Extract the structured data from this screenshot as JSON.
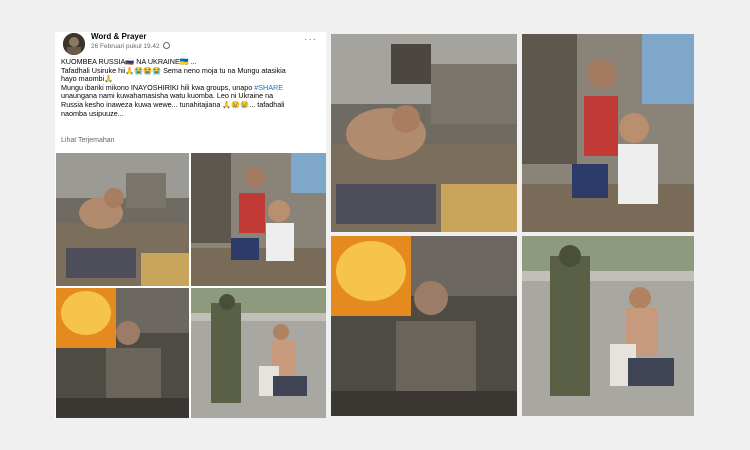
{
  "post": {
    "page_name": "Word & Prayer",
    "timestamp": "26 Februari pukul 19.42",
    "more_label": "···",
    "text_lines": [
      "KUOMBEA RUSSIA🇷🇺 NA UKRAINE🇺🇦 ...",
      "Tafadhali Usiruke hii🙏😭😭😭 Sema neno moja tu na Mungu atasikia",
      "hayo maombi🙏",
      "Mungu ibariki mikono INAYOSHIRIKI hili kwa groups, unapo",
      "unaungana nami kuwahamasisha watu kuomba. Leo ni Ukraine na",
      "Russia kesho inaweza kuwa wewe... tunahitajiana 🙏😢😢... tafadhali",
      "naomba usipuuze..."
    ],
    "hashtag": "#SHARE",
    "see_translation": "Lihat Terjemahan"
  },
  "photos": [
    {
      "name": "wounded-man-in-rubble"
    },
    {
      "name": "woman-carrying-child"
    },
    {
      "name": "woman-near-fire"
    },
    {
      "name": "soldier-and-kneeling-man"
    }
  ],
  "colors": {
    "page_bg": "#f0f0f0",
    "card_bg": "#ffffff",
    "hashtag": "#216fdb",
    "fire": "#f0a020"
  }
}
